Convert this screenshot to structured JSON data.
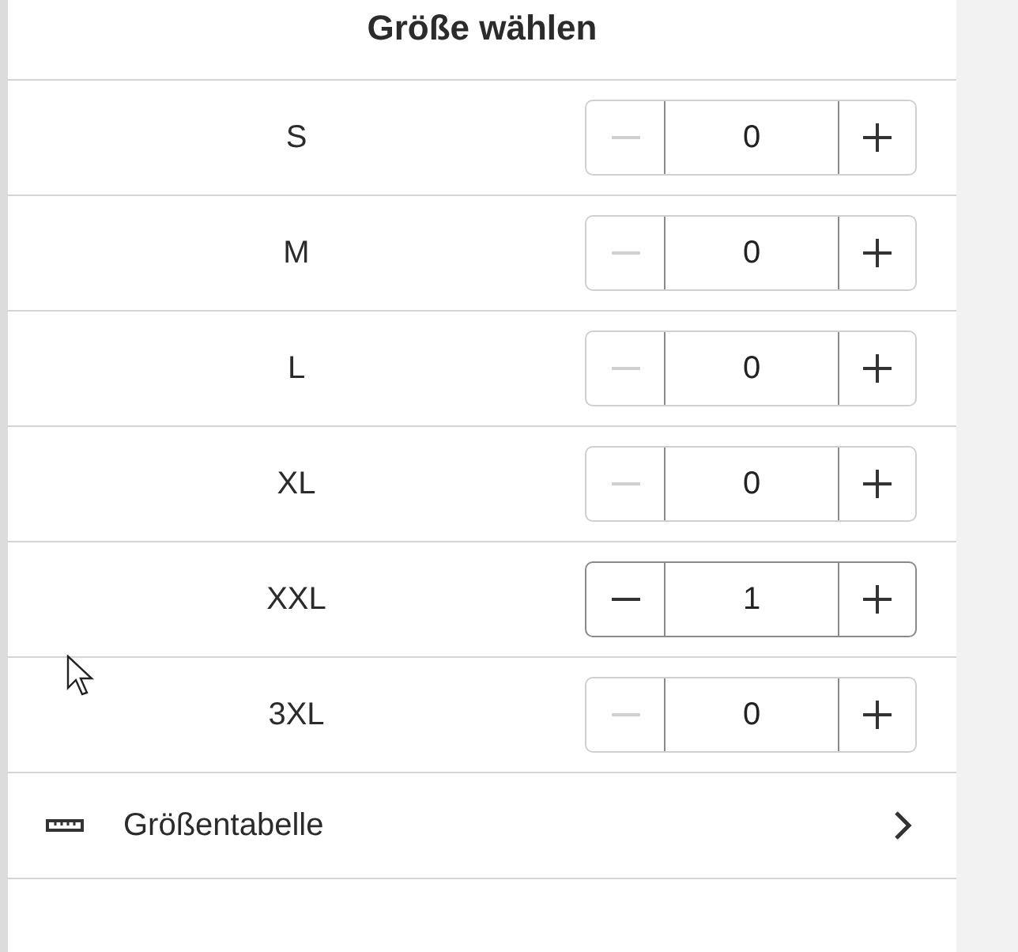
{
  "title": "Größe wählen",
  "sizes": [
    {
      "label": "S",
      "quantity": "0",
      "minus_disabled": true
    },
    {
      "label": "M",
      "quantity": "0",
      "minus_disabled": true
    },
    {
      "label": "L",
      "quantity": "0",
      "minus_disabled": true
    },
    {
      "label": "XL",
      "quantity": "0",
      "minus_disabled": true
    },
    {
      "label": "XXL",
      "quantity": "1",
      "minus_disabled": false
    },
    {
      "label": "3XL",
      "quantity": "0",
      "minus_disabled": true
    }
  ],
  "size_chart_link": {
    "label": "Größentabelle"
  }
}
